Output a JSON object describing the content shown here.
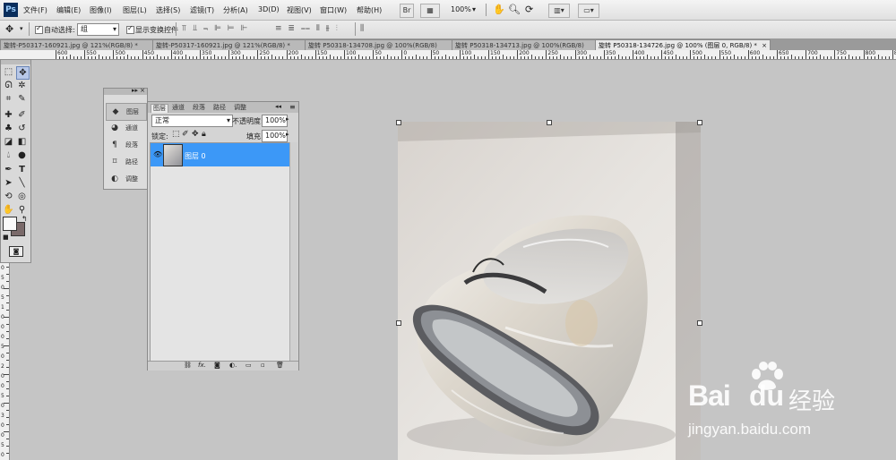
{
  "app": {
    "logo": "Ps"
  },
  "menu": [
    "文件(F)",
    "编辑(E)",
    "图像(I)",
    "图层(L)",
    "选择(S)",
    "滤镜(T)",
    "分析(A)",
    "3D(D)",
    "视图(V)",
    "窗口(W)",
    "帮助(H)"
  ],
  "menubar_right": {
    "br_label": "Br",
    "zoom": "100%"
  },
  "options": {
    "auto_select_label": "自动选择:",
    "auto_select_value": "组",
    "show_transform_label": "显示变换控件"
  },
  "tabs": [
    {
      "label": "旋转-P50317-160921.jpg @ 121%(RGB/8) *",
      "active": false
    },
    {
      "label": "旋转-P50317-160921.jpg @ 121%(RGB/8) *",
      "active": false
    },
    {
      "label": "旋转 P50318-134708.jpg @ 100%(RGB/8)",
      "active": false
    },
    {
      "label": "旋转 P50318-134713.jpg @ 100%(RGB/8)",
      "active": false
    },
    {
      "label": "旋转 P50318-134726.jpg @ 100% (图层 0, RGB/8) *",
      "active": true
    }
  ],
  "ruler": {
    "h_labels": [
      "600",
      "550",
      "500",
      "450",
      "400",
      "350",
      "300",
      "250",
      "200",
      "150",
      "100",
      "50",
      "0",
      "50",
      "100",
      "150",
      "200",
      "250",
      "300",
      "350",
      "400",
      "450",
      "500",
      "550",
      "600",
      "650",
      "700",
      "750",
      "800",
      "850"
    ],
    "v_labels": [
      "0",
      "5",
      "0",
      "5",
      "1",
      "0",
      "0",
      "0",
      "5",
      "0",
      "2",
      "0",
      "0",
      "5",
      "0",
      "3",
      "0",
      "0",
      "5",
      "0"
    ]
  },
  "dock": [
    {
      "label": "图层",
      "icon": "layers-icon",
      "glyph": "◆"
    },
    {
      "label": "通道",
      "icon": "channels-icon",
      "glyph": "◕"
    },
    {
      "label": "段落",
      "icon": "paragraph-icon",
      "glyph": "¶"
    },
    {
      "label": "路径",
      "icon": "paths-icon",
      "glyph": "⌑"
    },
    {
      "label": "调整",
      "icon": "adjustments-icon",
      "glyph": "◐"
    }
  ],
  "layers_panel": {
    "tabs": [
      "图层",
      "通道",
      "段落",
      "路径",
      "调整"
    ],
    "blend_mode": "正常",
    "opacity_label": "不透明度:",
    "opacity_value": "100%",
    "lock_label": "锁定:",
    "fill_label": "填充:",
    "fill_value": "100%",
    "layers": [
      {
        "name": "图层 0",
        "visible": true,
        "selected": true
      }
    ]
  },
  "watermark": {
    "brand": "Bai",
    "brand2": "du",
    "cn": "经验",
    "url": "jingyan.baidu.com"
  },
  "colors": {
    "selection": "#3c98f7",
    "accent": "#0a2e5c",
    "watermark": "#ffffff"
  }
}
